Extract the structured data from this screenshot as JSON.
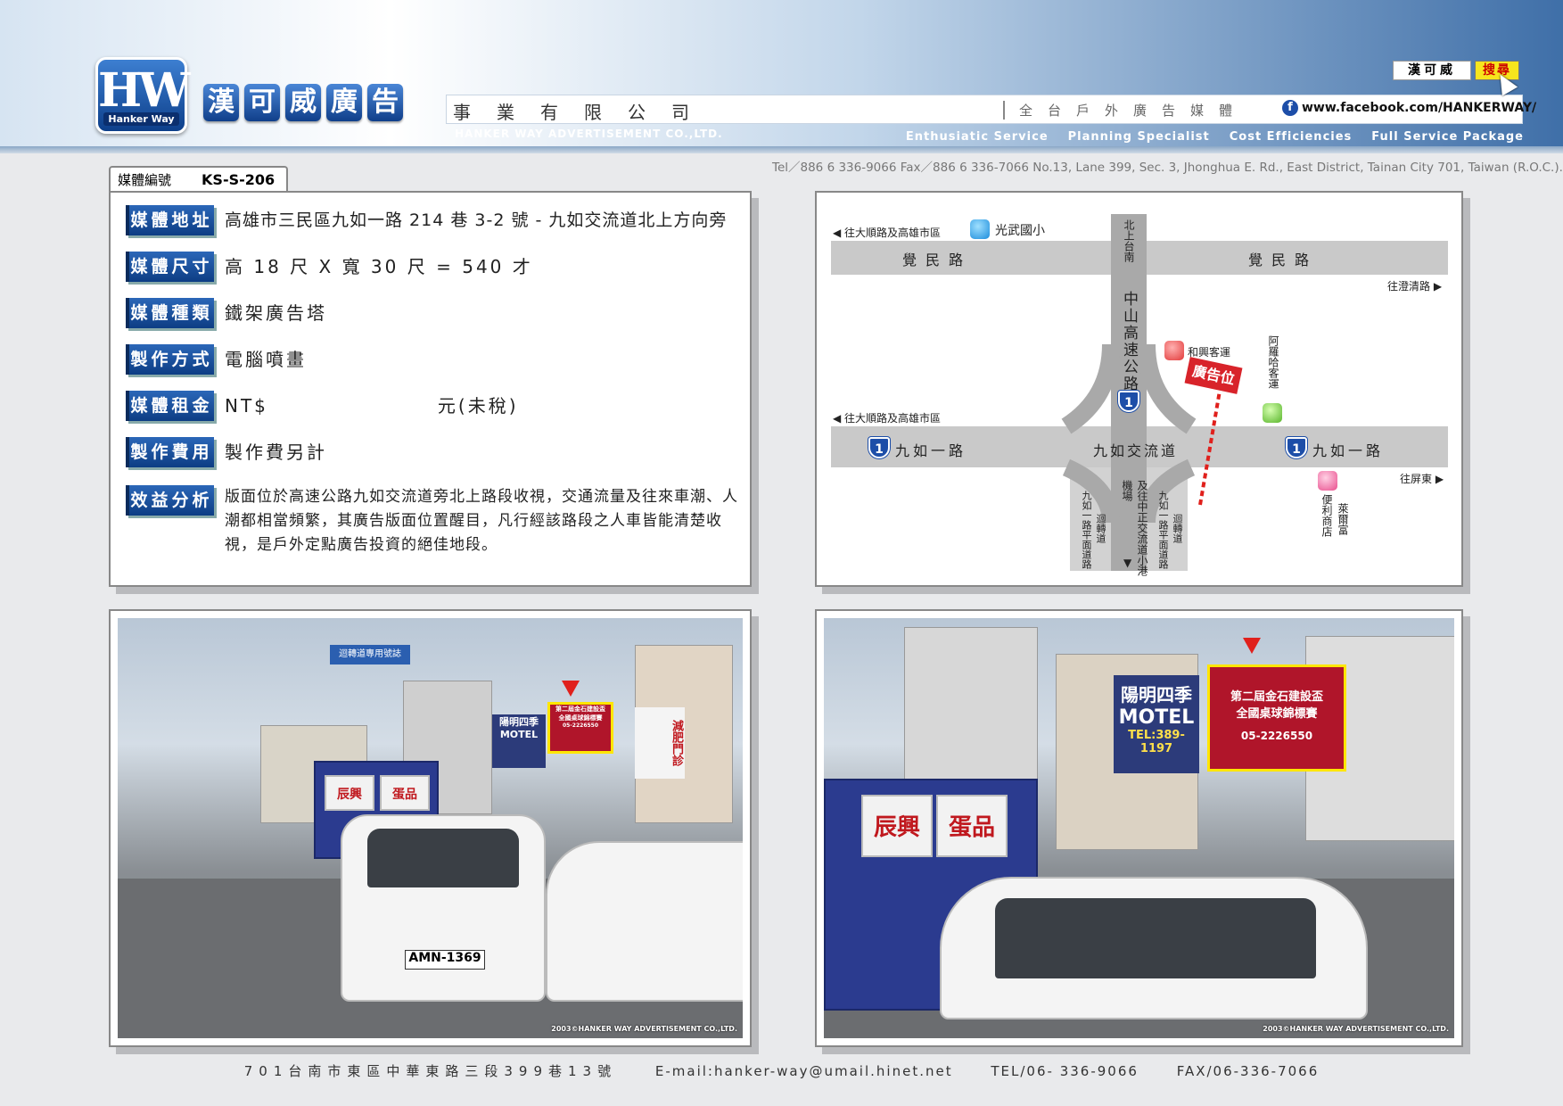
{
  "header": {
    "logo_text": "HW",
    "logo_sub": "Hanker Way",
    "brand_chars": [
      "漢",
      "可",
      "威",
      "廣",
      "告"
    ],
    "company_suffix": "事業有限公司",
    "company_en": "HANKER WAY ADVERTISEMENT CO.,LTD.",
    "media_label": "全台戶外廣告媒體",
    "facebook": "www.facebook.com/HANKERWAY/",
    "search_value": "漢可威",
    "search_button": "搜尋",
    "services": [
      "Enthusiatic Service",
      "Planning Specialist",
      "Cost Efficiencies",
      "Full Service Package"
    ],
    "contact_line": "Tel／886 6 336-9066   Fax／886 6 336-7066   No.13, Lane 399, Sec. 3, Jhonghua E. Rd., East District, Tainan City 701, Taiwan (R.O.C.)."
  },
  "media_tab": {
    "label": "媒體編號",
    "number": "KS-S-206"
  },
  "info": {
    "rows": [
      {
        "label": "媒體地址",
        "value": "高雄市三民區九如一路 214 巷 3-2 號 - 九如交流道北上方向旁"
      },
      {
        "label": "媒體尺寸",
        "value": "高 18 尺 X 寬 30 尺 = 540 才"
      },
      {
        "label": "媒體種類",
        "value": "鐵架廣告塔"
      },
      {
        "label": "製作方式",
        "value": "電腦噴畫"
      },
      {
        "label": "媒體租金",
        "value": "NT$",
        "unit": "元(未稅)"
      },
      {
        "label": "製作費用",
        "value": "製作費另計"
      },
      {
        "label": "效益分析",
        "value": "版面位於高速公路九如交流道旁北上路段收視，交通流量及往來車潮、人潮都相當頻繁，其廣告版面位置醒目，凡行經該路段之人車皆能清楚收視，是戶外定點廣告投資的絕佳地段。"
      }
    ]
  },
  "map": {
    "top_left_arrow": "往大順路及高雄市區",
    "school": "光武國小",
    "road_top_left": "覺民路",
    "road_top_right": "覺民路",
    "to_chengqing": "往澄清路",
    "north_south": "北上台南",
    "highway": "中山高速公路",
    "highway_shield": "1",
    "bus_heyxing": "和興客運",
    "bus_aloha": "阿羅哈客運",
    "ad_position": "廣告位置",
    "mid_left_arrow": "往大順路及高雄市區",
    "road_mid_left": "九如一路",
    "interchange": "九如交流道",
    "road_mid_right": "九如一路",
    "to_pingtung": "往屏東",
    "bottom_left_ramp": "九如一路平面道路",
    "bottom_left_ramp2": "迴轉道",
    "bottom_center": "及往中正交流道小港機場",
    "bottom_right_ramp": "九如一路平面道路",
    "bottom_right_ramp2": "迴轉道",
    "store": "便利商店",
    "store2": "萊爾富"
  },
  "photos": {
    "copyright": "2003©HANKER WAY ADVERTISEMENT CO.,LTD.",
    "billboard_line1": "第二屆金石建設盃",
    "billboard_line2": "全國桌球錦標賽",
    "billboard_phone": "05-2226550",
    "motel_name": "陽明四季",
    "motel_text": "MOTEL",
    "motel_tel": "TEL:389-1197",
    "truck_left": "辰興",
    "truck_right": "蛋品",
    "plate": "AMN-1369",
    "sign_turn": "迴轉道專用號誌",
    "sign_slim": "減肥門診"
  },
  "footer": {
    "address": "701台南市東區中華東路三段399巷13號",
    "email": "E-mail:hanker-way@umail.hinet.net",
    "tel": "TEL/06- 336-9066",
    "fax": "FAX/06-336-7066"
  }
}
